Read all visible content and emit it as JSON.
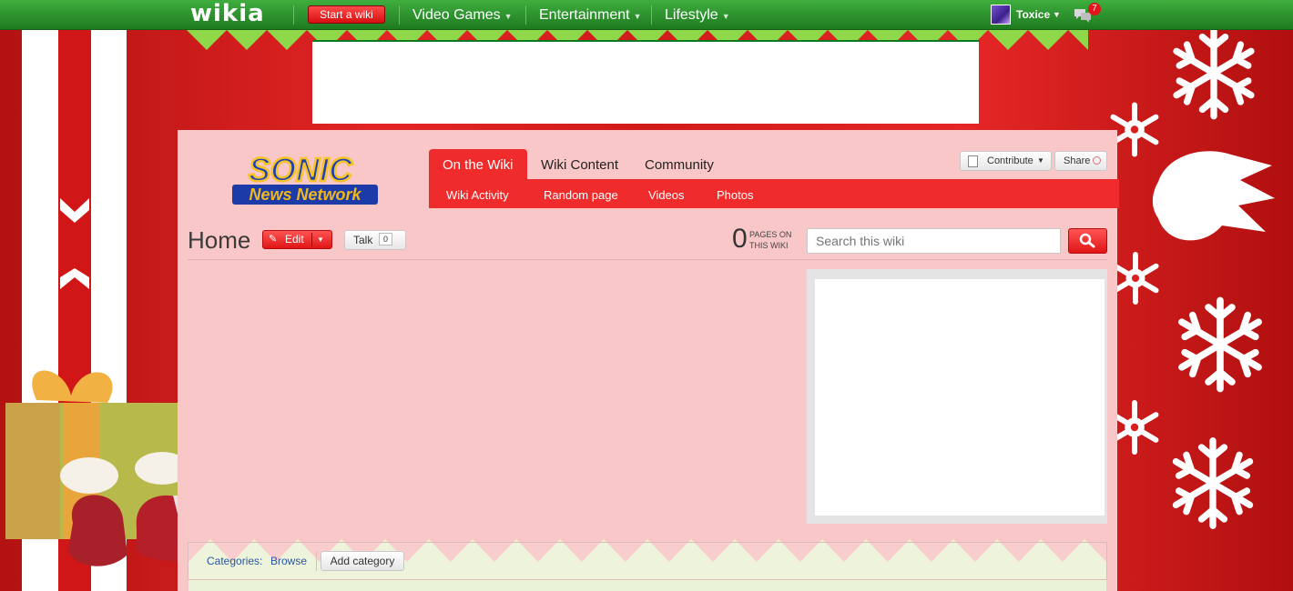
{
  "global_nav": {
    "logo": "wikia",
    "start_wiki": "Start a wiki",
    "hubs": [
      {
        "label": "Video Games"
      },
      {
        "label": "Entertainment"
      },
      {
        "label": "Lifestyle"
      }
    ],
    "user": {
      "name": "Toxice"
    },
    "notifications": {
      "count": "7"
    }
  },
  "wiki": {
    "logo_line1": "SONIC",
    "logo_line2": "News Network",
    "tabs": [
      "On the Wiki",
      "Wiki Content",
      "Community"
    ],
    "subnav": [
      "Wiki Activity",
      "Random page",
      "Videos",
      "Photos"
    ],
    "contribute_label": "Contribute",
    "share_label": "Share"
  },
  "page_header": {
    "title": "Home",
    "edit_label": "Edit",
    "talk_label": "Talk",
    "talk_count": "0",
    "page_count": "0",
    "page_count_label_1": "PAGES ON",
    "page_count_label_2": "THIS WIKI",
    "search_placeholder": "Search this wiki"
  },
  "categories": {
    "label": "Categories:",
    "browse": "Browse",
    "add_label": "Add category"
  },
  "colors": {
    "topbar_green": "#2f9a2f",
    "accent_red": "#f02b2b",
    "page_bg": "#f9c7c7"
  }
}
